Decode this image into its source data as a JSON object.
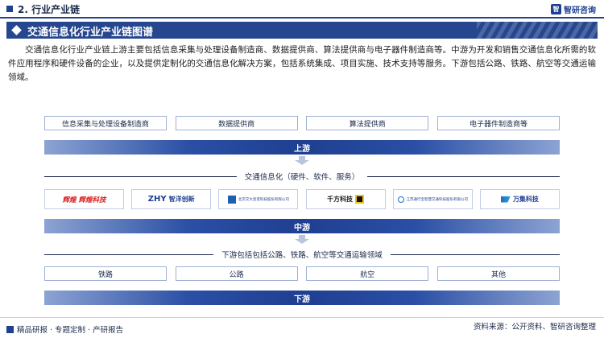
{
  "header": {
    "section_title": "2. 行业产业链",
    "brand_name": "智研咨询"
  },
  "banner": {
    "title": "交通信息化行业产业链图谱"
  },
  "description": "交通信息化行业产业链上游主要包括信息采集与处理设备制造商、数据提供商、算法提供商与电子器件制造商等。中游为开发和销售交通信息化所需的软件应用程序和硬件设备的企业，以及提供定制化的交通信息化解决方案，包括系统集成、项目实施、技术支持等服务。下游包括公路、铁路、航空等交通运输领域。",
  "upstream": {
    "items": [
      "信息采集与处理设备制造商",
      "数据提供商",
      "算法提供商",
      "电子器件制造商等"
    ],
    "label": "上游"
  },
  "midstream": {
    "title": "交通信息化（硬件、软件、服务）",
    "logos": [
      {
        "text": "辉煌",
        "text2": "辉煌科技",
        "icon": "huihuang-logo"
      },
      {
        "text": "ZHY",
        "text2": "智洋创新",
        "icon": "zhiyang-logo"
      },
      {
        "text": "北京交大思诺科技股份有限公司",
        "text2": "",
        "icon": "sinuo-logo"
      },
      {
        "text": "千方科技",
        "text2": "",
        "icon": "qianfang-logo"
      },
      {
        "text": "江苏通行宝智慧交通科技股份有限公司",
        "text2": "",
        "icon": "tongxingbao-logo"
      },
      {
        "text": "万集科技",
        "text2": "",
        "icon": "wanji-logo"
      }
    ],
    "label": "中游"
  },
  "downstream": {
    "title": "下游包括包括公路、铁路、航空等交通运输领域",
    "items": [
      "铁路",
      "公路",
      "航空",
      "其他"
    ],
    "label": "下游"
  },
  "footer": {
    "left": "精品研报 · 专题定制 · 产研报告",
    "right": "资料来源：公开资料、智研咨询整理"
  },
  "colors": {
    "primary": "#1f3f91",
    "accent_red": "#d81e1e"
  }
}
